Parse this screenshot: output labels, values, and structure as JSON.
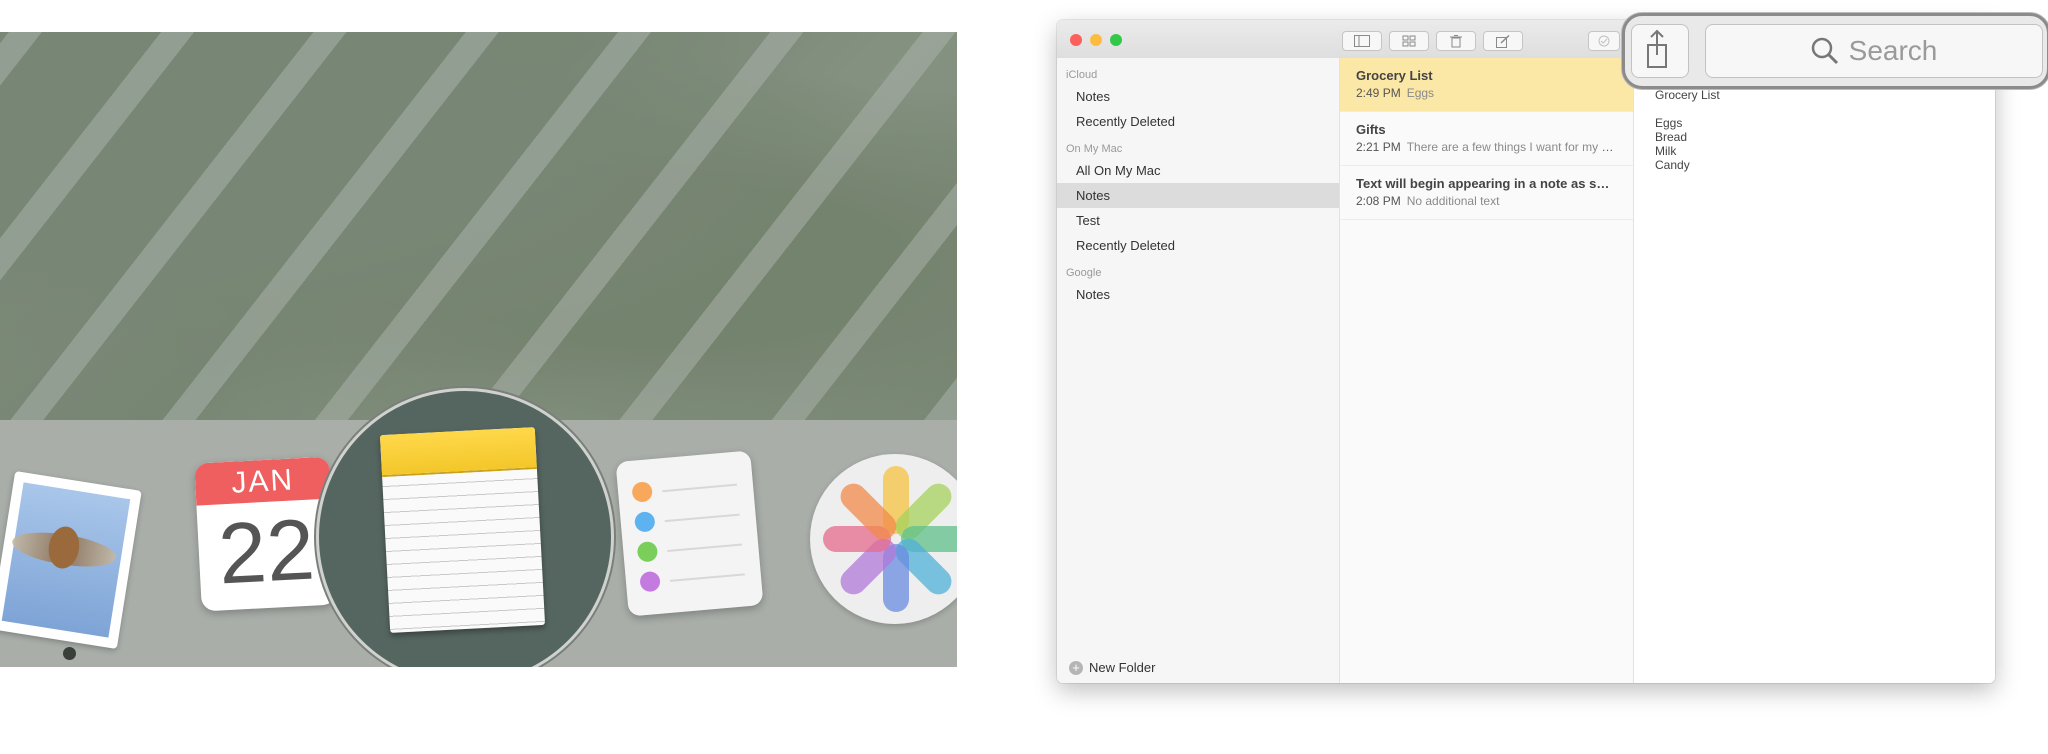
{
  "dock": {
    "calendar_month": "JAN",
    "calendar_day": "22"
  },
  "notes_app": {
    "sidebar": {
      "sections": [
        {
          "title": "iCloud",
          "items": [
            "Notes",
            "Recently Deleted"
          ]
        },
        {
          "title": "On My Mac",
          "items": [
            "All On My Mac",
            "Notes",
            "Test",
            "Recently Deleted"
          ]
        },
        {
          "title": "Google",
          "items": [
            "Notes"
          ]
        }
      ],
      "selected": "On My Mac/Notes",
      "new_folder_label": "New Folder"
    },
    "notes": [
      {
        "title": "Grocery List",
        "time": "2:49 PM",
        "preview": "Eggs"
      },
      {
        "title": "Gifts",
        "time": "2:21 PM",
        "preview": "There are a few things I want for my bi..."
      },
      {
        "title": "Text will begin appearing in a note as soo...",
        "time": "2:08 PM",
        "preview": "No additional text"
      }
    ],
    "editor": {
      "title": "Grocery List",
      "lines": [
        "Eggs",
        "Bread",
        "Milk",
        "Candy"
      ]
    },
    "search_placeholder": "Search"
  }
}
